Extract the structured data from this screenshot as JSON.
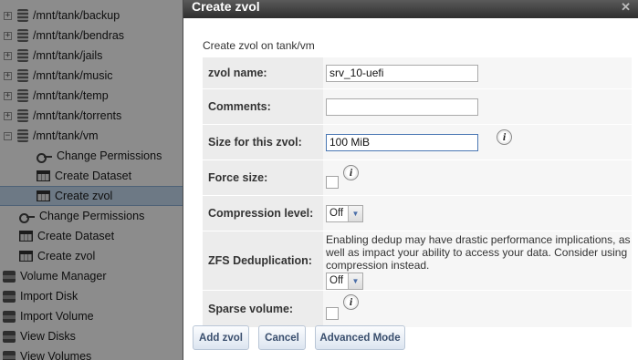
{
  "tree": {
    "items": [
      {
        "label": "/mnt/tank/backup",
        "expander": "+"
      },
      {
        "label": "/mnt/tank/bendras",
        "expander": "+"
      },
      {
        "label": "/mnt/tank/jails",
        "expander": "+"
      },
      {
        "label": "/mnt/tank/music",
        "expander": "+"
      },
      {
        "label": "/mnt/tank/temp",
        "expander": "+"
      },
      {
        "label": "/mnt/tank/torrents",
        "expander": "+"
      },
      {
        "label": "/mnt/tank/vm",
        "expander": "−"
      },
      {
        "label": "Change Permissions"
      },
      {
        "label": "Create Dataset"
      },
      {
        "label": "Create zvol"
      },
      {
        "label": "Change Permissions"
      },
      {
        "label": "Create Dataset"
      },
      {
        "label": "Create zvol"
      },
      {
        "label": "Volume Manager"
      },
      {
        "label": "Import Disk"
      },
      {
        "label": "Import Volume"
      },
      {
        "label": "View Disks"
      },
      {
        "label": "View Volumes"
      }
    ]
  },
  "dialog": {
    "title": "Create zvol",
    "close_glyph": "✕",
    "subtitle": "Create zvol on tank/vm",
    "fields": {
      "zvol_name": {
        "label": "zvol name:",
        "value": "srv_10-uefi"
      },
      "comments": {
        "label": "Comments:",
        "value": ""
      },
      "size": {
        "label": "Size for this zvol:",
        "value": "100 MiB"
      },
      "force_size": {
        "label": "Force size:",
        "checked": false
      },
      "compression": {
        "label": "Compression level:",
        "selected": "Off"
      },
      "dedup": {
        "label": "ZFS Deduplication:",
        "warning": "Enabling dedup may have drastic performance implications, as well as impact your ability to access your data. Consider using compression instead.",
        "selected": "Off"
      },
      "sparse": {
        "label": "Sparse volume:",
        "checked": false
      }
    },
    "info_glyph": "i",
    "dropdown_arrow": "▼",
    "buttons": {
      "add": "Add zvol",
      "cancel": "Cancel",
      "advanced": "Advanced Mode"
    }
  }
}
